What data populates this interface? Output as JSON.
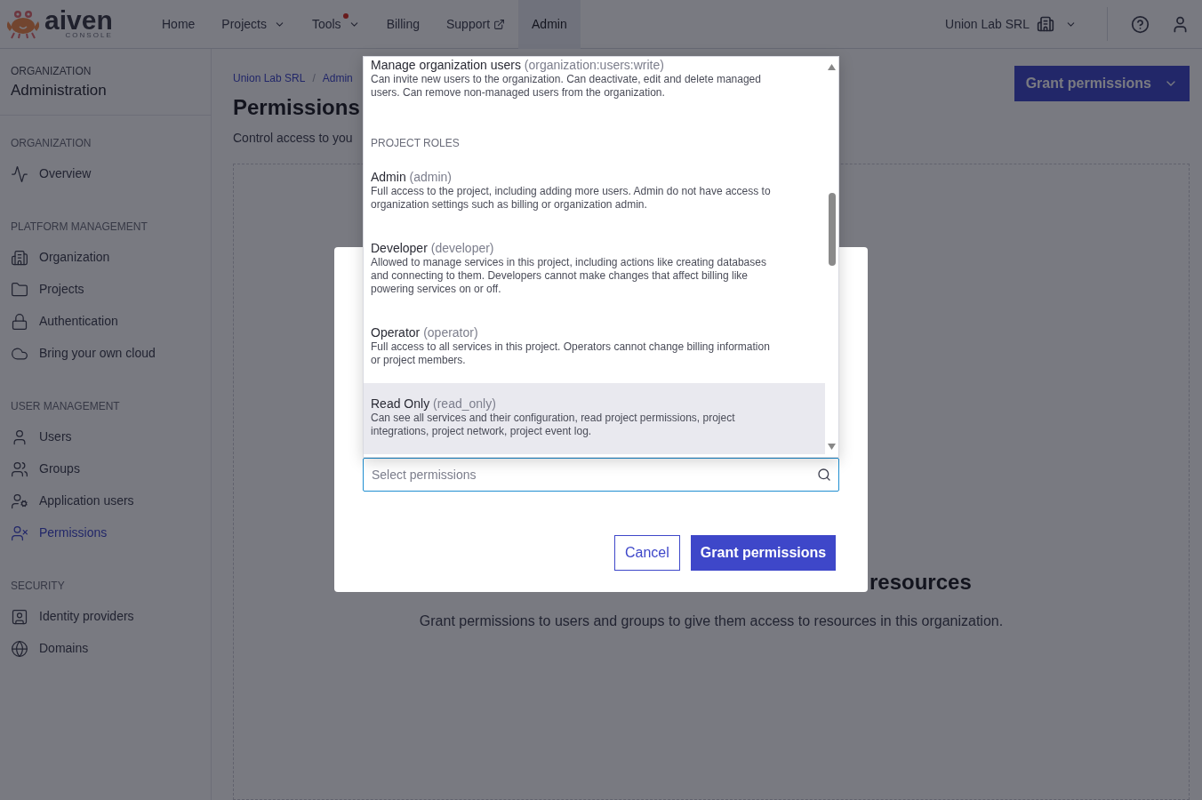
{
  "header": {
    "logo": {
      "name": "aiven",
      "sub": "CONSOLE"
    },
    "nav": [
      {
        "label": "Home",
        "selected": false,
        "kind": "plain"
      },
      {
        "label": "Projects",
        "selected": false,
        "kind": "menu"
      },
      {
        "label": "Tools",
        "selected": false,
        "kind": "menu-dot"
      },
      {
        "label": "Billing",
        "selected": false,
        "kind": "plain"
      },
      {
        "label": "Support",
        "selected": false,
        "kind": "external"
      },
      {
        "label": "Admin",
        "selected": true,
        "kind": "plain"
      }
    ],
    "organization": "Union Lab SRL"
  },
  "sidebar": {
    "eyebrow": "ORGANIZATION",
    "title": "Administration",
    "sections": [
      {
        "heading": "ORGANIZATION",
        "items": [
          {
            "label": "Overview",
            "selected": false
          }
        ]
      },
      {
        "heading": "PLATFORM MANAGEMENT",
        "items": [
          {
            "label": "Organization",
            "selected": false
          },
          {
            "label": "Projects",
            "selected": false
          },
          {
            "label": "Authentication",
            "selected": false
          },
          {
            "label": "Bring your own cloud",
            "selected": false
          }
        ]
      },
      {
        "heading": "USER MANAGEMENT",
        "items": [
          {
            "label": "Users",
            "selected": false
          },
          {
            "label": "Groups",
            "selected": false
          },
          {
            "label": "Application users",
            "selected": false
          },
          {
            "label": "Permissions",
            "selected": true
          }
        ]
      },
      {
        "heading": "SECURITY",
        "items": [
          {
            "label": "Identity providers",
            "selected": false
          },
          {
            "label": "Domains",
            "selected": false
          }
        ]
      }
    ]
  },
  "main": {
    "breadcrumb": [
      "Union Lab SRL",
      "Admin"
    ],
    "breadcrumb_separator": "/",
    "title": "Permissions",
    "subtitle": "Control access to you",
    "action": "Grant permissions",
    "empty": {
      "title": "resources",
      "text": "Grant permissions to users and groups to give them access to resources in this organization."
    }
  },
  "dialog": {
    "dropdown": {
      "items": [
        {
          "kind": "option",
          "name": "Manage organization users",
          "code": "(organization:users:write)",
          "description": "Can invite new users to the organization. Can deactivate, edit and delete managed users. Can remove non-managed users from the organization.",
          "highlighted": false
        },
        {
          "kind": "header",
          "name": "PROJECT ROLES"
        },
        {
          "kind": "option",
          "name": "Admin",
          "code": "(admin)",
          "description": "Full access to the project, including adding more users. Admin do not have access to organization settings such as billing or organization admin.",
          "highlighted": false
        },
        {
          "kind": "option",
          "name": "Developer",
          "code": "(developer)",
          "description": "Allowed to manage services in this project, including actions like creating databases and connecting to them. Developers cannot make changes that affect billing like powering services on or off.",
          "highlighted": false
        },
        {
          "kind": "option",
          "name": "Operator",
          "code": "(operator)",
          "description": "Full access to all services in this project. Operators cannot change billing information or project members.",
          "highlighted": false
        },
        {
          "kind": "option",
          "name": "Read Only",
          "code": "(read_only)",
          "description": "Can see all services and their configuration, read project permissions, project integrations, project network, project event log.",
          "highlighted": true
        }
      ]
    },
    "search": {
      "placeholder": "Select permissions"
    },
    "buttons": [
      {
        "label": "Cancel",
        "kind": "secondary"
      },
      {
        "label": "Grant permissions",
        "kind": "primary"
      }
    ]
  }
}
